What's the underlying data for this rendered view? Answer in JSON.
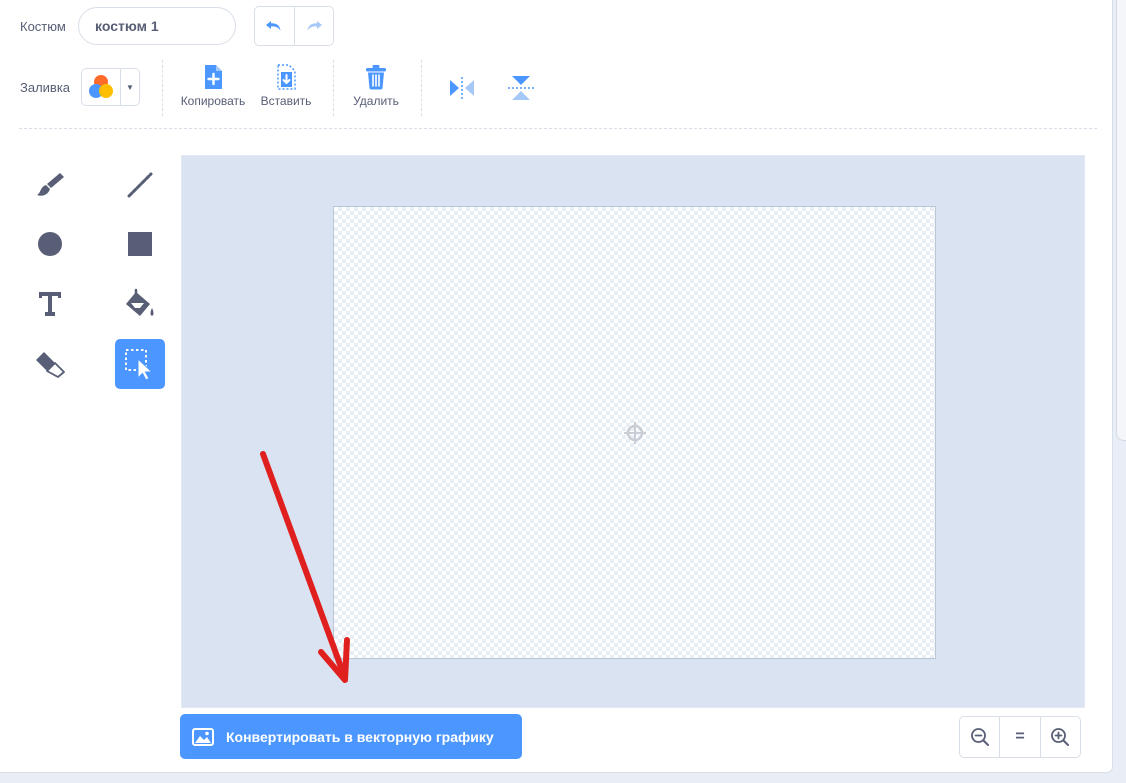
{
  "costume": {
    "label": "Костюм",
    "name_value": "костюм 1"
  },
  "fill": {
    "label": "Заливка"
  },
  "toolbar": {
    "copy_label": "Копировать",
    "paste_label": "Вставить",
    "delete_label": "Удалить"
  },
  "tools": {
    "active": "select"
  },
  "convert": {
    "label": "Конвертировать в векторную графику"
  },
  "zoom": {
    "reset_label": "="
  },
  "colors": {
    "accent": "#4c97ff",
    "text": "#575e75",
    "canvas_bg": "#d9e3f2",
    "annotation_arrow": "#e0201f"
  }
}
